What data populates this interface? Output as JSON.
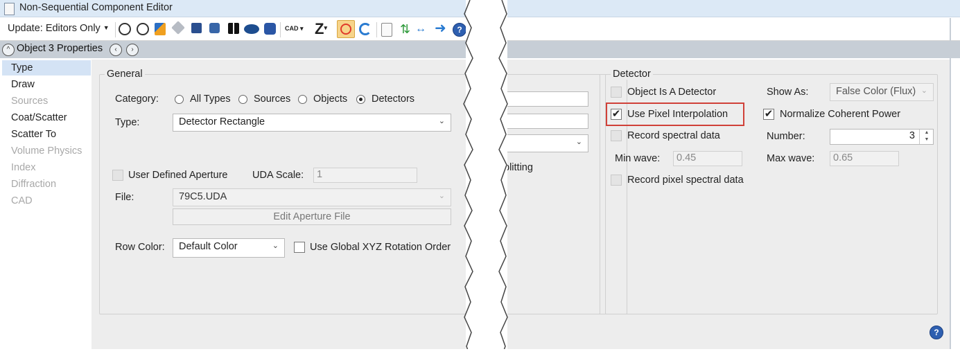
{
  "window": {
    "title": "Non-Sequential Component Editor"
  },
  "toolbar": {
    "update_label": "Update: Editors Only",
    "cad_label": "CAD",
    "z_label": "Z",
    "icons": [
      "refresh-icon",
      "refresh-all-icon",
      "wand-icon",
      "cube-grey-icon",
      "cube-blue-icon",
      "cubes-icon",
      "grid-icon",
      "ellipses-icon",
      "hexagon-icon",
      "cad-icon",
      "zemax-z-icon",
      "no-entry-icon",
      "undo-icon",
      "page-icon",
      "swap-icon",
      "lens-icon",
      "arrow-right-icon",
      "help-icon"
    ]
  },
  "panel": {
    "title": "Object 3 Properties"
  },
  "sidebar": {
    "items": [
      {
        "label": "Type",
        "state": "selected"
      },
      {
        "label": "Draw",
        "state": "enabled"
      },
      {
        "label": "Sources",
        "state": "disabled"
      },
      {
        "label": "Coat/Scatter",
        "state": "enabled"
      },
      {
        "label": "Scatter To",
        "state": "enabled"
      },
      {
        "label": "Volume Physics",
        "state": "disabled"
      },
      {
        "label": "Index",
        "state": "disabled"
      },
      {
        "label": "Diffraction",
        "state": "disabled"
      },
      {
        "label": "CAD",
        "state": "disabled"
      }
    ]
  },
  "general": {
    "legend": "General",
    "category_label": "Category:",
    "category_options": [
      "All Types",
      "Sources",
      "Objects",
      "Detectors"
    ],
    "category_selected": "Detectors",
    "type_label": "Type:",
    "type_value": "Detector Rectangle",
    "uda_label": "User Defined Aperture",
    "uda_scale_label": "UDA Scale:",
    "uda_scale_value": "1",
    "file_label": "File:",
    "file_value": "79C5.UDA",
    "edit_aperture_label": "Edit Aperture File",
    "row_color_label": "Row Color:",
    "row_color_value": "Default Color",
    "global_xyz_label": "Use Global XYZ Rotation Order"
  },
  "middle": {
    "partial_text": "plitting"
  },
  "detector": {
    "legend": "Detector",
    "object_is_detector": {
      "label": "Object Is A Detector",
      "checked": false
    },
    "use_pixel_interp": {
      "label": "Use Pixel Interpolation",
      "checked": true
    },
    "record_spectral": {
      "label": "Record spectral data",
      "checked": false
    },
    "min_wave_label": "Min wave:",
    "min_wave_value": "0.45",
    "record_pixel_spectral": {
      "label": "Record pixel spectral data",
      "checked": false
    },
    "show_as_label": "Show As:",
    "show_as_value": "False Color (Flux)",
    "normalize": {
      "label": "Normalize Coherent Power",
      "checked": true
    },
    "number_label": "Number:",
    "number_value": "3",
    "max_wave_label": "Max wave:",
    "max_wave_value": "0.65"
  },
  "colors": {
    "highlight": "#d04038",
    "selection": "#d4e3f5",
    "panel_bg": "#ededed",
    "title_bg": "#dce9f6"
  }
}
